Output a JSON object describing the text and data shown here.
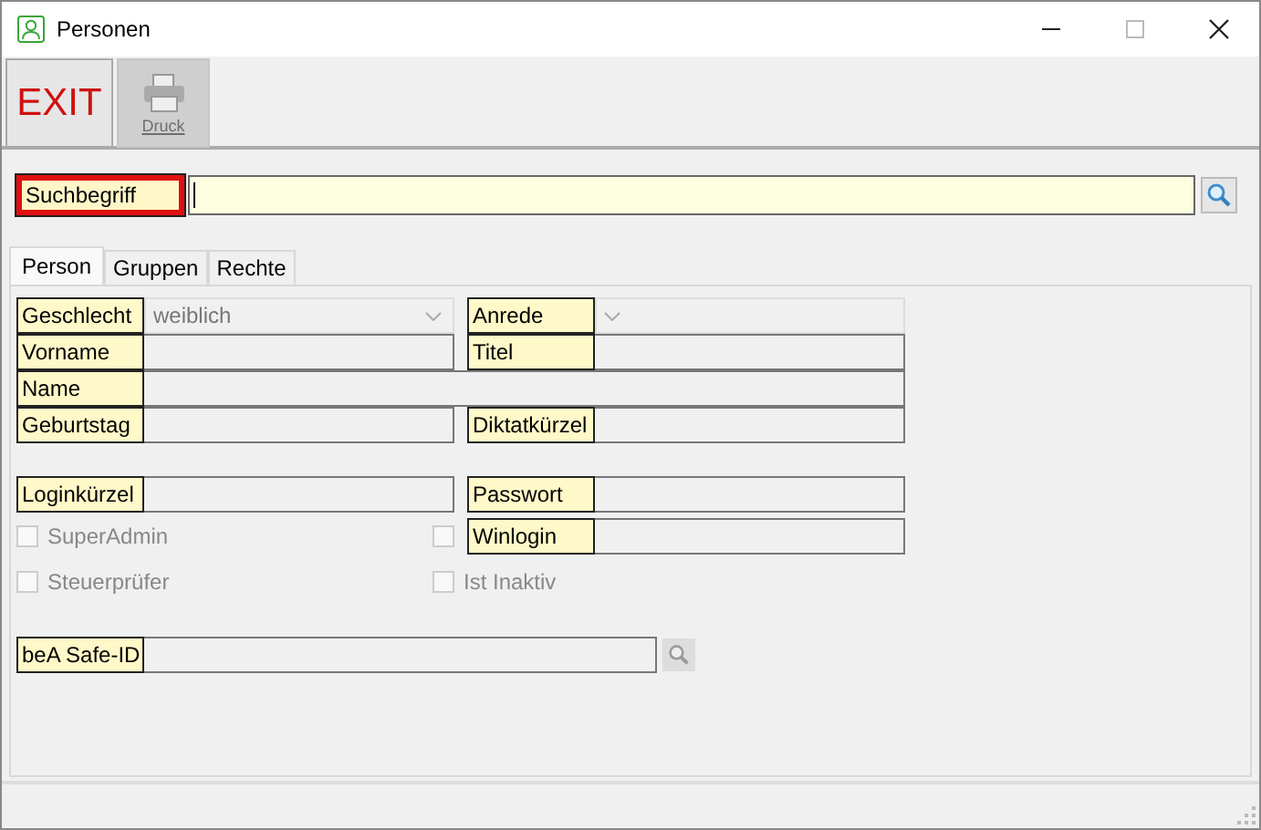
{
  "window": {
    "title": "Personen"
  },
  "toolbar": [
    {
      "kind": "exit",
      "label": "EXIT",
      "disabled": false
    },
    {
      "kind": "print",
      "label": "Druck",
      "disabled": true
    }
  ],
  "search": {
    "label": "Suchbegriff",
    "focused": true
  },
  "tabs": [
    {
      "label": "Person",
      "selected": true
    },
    {
      "label": "Gruppen",
      "selected": false
    },
    {
      "label": "Rechte",
      "selected": false
    }
  ],
  "form": {
    "sections": [
      {
        "rows": [
          {
            "fields": [
              {
                "kind": "combo",
                "label": "Geschlecht",
                "value": "weiblich"
              },
              {
                "kind": "combo",
                "label": "Anrede"
              }
            ]
          },
          {
            "fields": [
              {
                "kind": "text",
                "label": "Vorname"
              },
              {
                "kind": "text",
                "label": "Titel"
              }
            ]
          },
          {
            "fields": [
              {
                "kind": "wide",
                "label": "Name"
              }
            ]
          },
          {
            "fields": [
              {
                "kind": "text",
                "label": "Geburtstag"
              },
              {
                "kind": "text",
                "label": "Diktatkürzel"
              }
            ]
          }
        ]
      },
      {
        "rows": [
          {
            "fields": [
              {
                "kind": "text",
                "label": "Loginkürzel"
              },
              {
                "kind": "text",
                "label": "Passwort"
              }
            ]
          },
          {
            "fields": [
              {
                "kind": "checkbox",
                "label": "SuperAdmin",
                "checked": false,
                "disabled": true
              },
              {
                "kind": "checktext",
                "label": "Winlogin",
                "checked": false,
                "disabled": true
              }
            ]
          },
          {
            "fields": [
              {
                "kind": "checkbox",
                "label": "Steuerprüfer",
                "checked": false,
                "disabled": true
              },
              {
                "kind": "checkbox",
                "label": "Ist Inaktiv",
                "checked": false,
                "disabled": true
              }
            ]
          }
        ]
      },
      {
        "rows": [
          {
            "fields": [
              {
                "kind": "lookup",
                "label": "beA Safe-ID"
              }
            ]
          }
        ]
      }
    ]
  }
}
